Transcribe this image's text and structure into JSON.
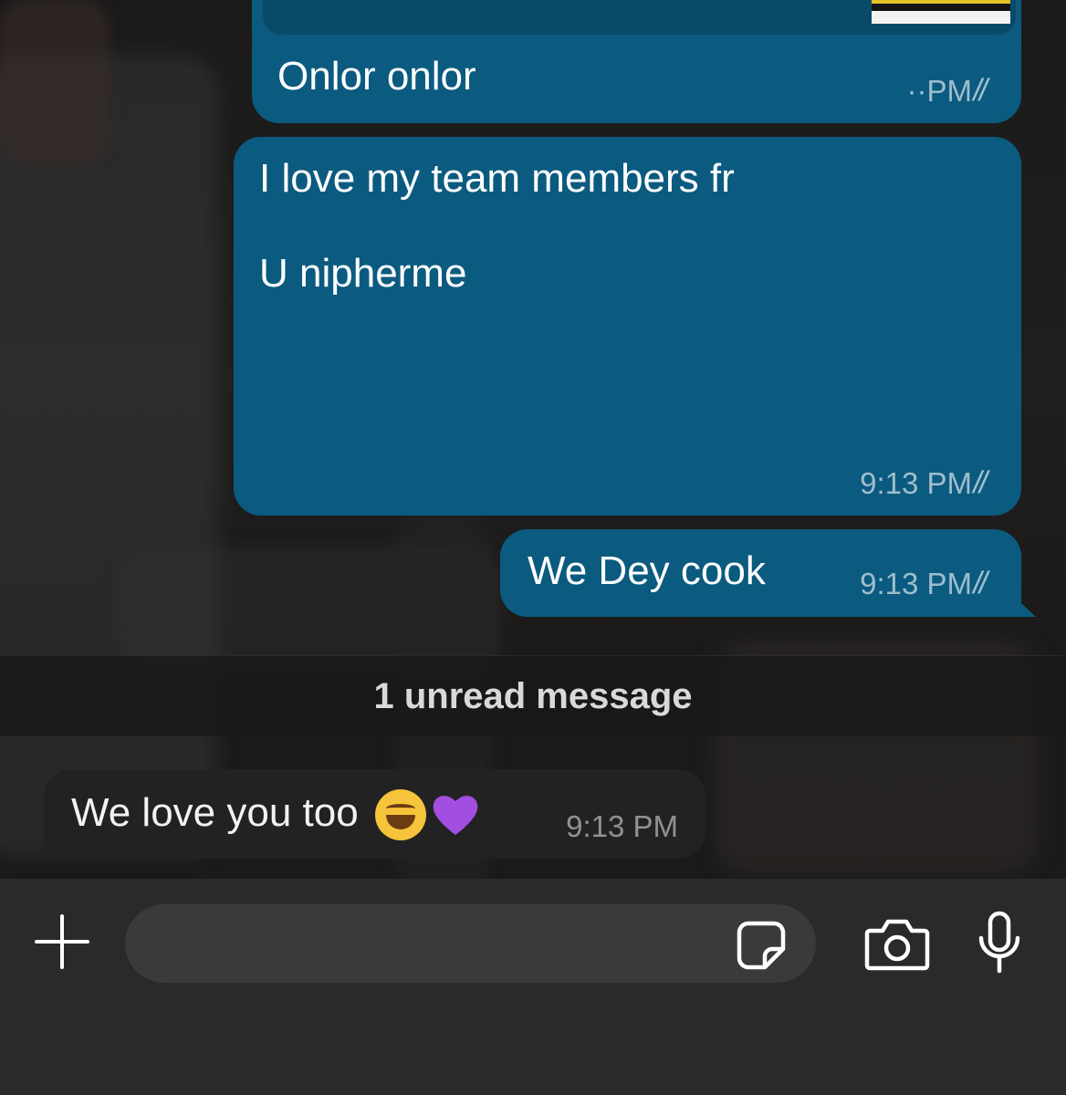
{
  "messages": [
    {
      "direction": "outgoing",
      "text": "Onlor onlor",
      "time": "··PM",
      "status_icon": "double-check-icon"
    },
    {
      "direction": "outgoing",
      "text": "I love my team members fr\n\nU nipherme",
      "time": "9:13 PM",
      "status_icon": "double-check-icon"
    },
    {
      "direction": "outgoing",
      "text": "We Dey cook",
      "time": "9:13 PM",
      "status_icon": "double-check-icon"
    },
    {
      "direction": "incoming",
      "text": "We love you too",
      "emojis": [
        "face-with-tears-of-joy",
        "purple-heart"
      ],
      "time": "9:13 PM"
    }
  ],
  "unread_separator": "1 unread message",
  "composer": {
    "placeholder": "",
    "icons": [
      "plus-icon",
      "sticker-icon",
      "camera-icon",
      "microphone-icon"
    ]
  },
  "colors": {
    "outgoing_bubble": "#0b5a80",
    "incoming_bubble": "#222222",
    "input_bar": "#2a2a2b"
  }
}
